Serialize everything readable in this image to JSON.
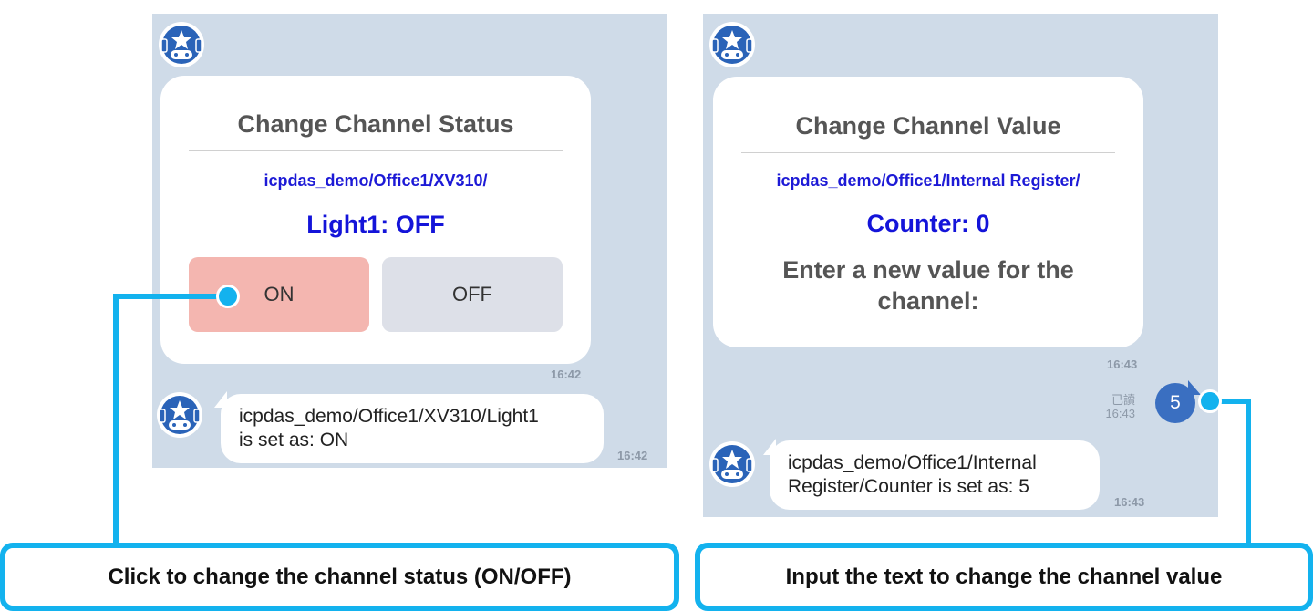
{
  "left": {
    "card_title": "Change Channel Status",
    "path": "icpdas_demo/Office1/XV310/",
    "status": "Light1: OFF",
    "on_label": "ON",
    "off_label": "OFF",
    "card_time": "16:42",
    "reply_text_line1": "icpdas_demo/Office1/XV310/Light1",
    "reply_text_line2": "is set as: ON",
    "reply_time": "16:42"
  },
  "right": {
    "card_title": "Change Channel Value",
    "path": "icpdas_demo/Office1/Internal Register/",
    "status": "Counter: 0",
    "prompt_line1": "Enter a new value for the",
    "prompt_line2": "channel:",
    "card_time": "16:43",
    "read_label": "已讀",
    "read_time": "16:43",
    "user_message": "5",
    "reply_text_line1": "icpdas_demo/Office1/Internal",
    "reply_text_line2": "Register/Counter  is set as: 5",
    "reply_time": "16:43"
  },
  "callouts": {
    "left": "Click to change the channel status (ON/OFF)",
    "right": "Input the text to change the channel value"
  },
  "colors": {
    "chat_background": "#cfdbe8",
    "on_button": "#f4b6b0",
    "off_button": "#dde0e8",
    "link_blue": "#1d1ad6",
    "callout": "#13b2ee",
    "user_bubble": "#3a6fc1"
  },
  "icons": {
    "bot_avatar": "robot-star-avatar-icon"
  }
}
